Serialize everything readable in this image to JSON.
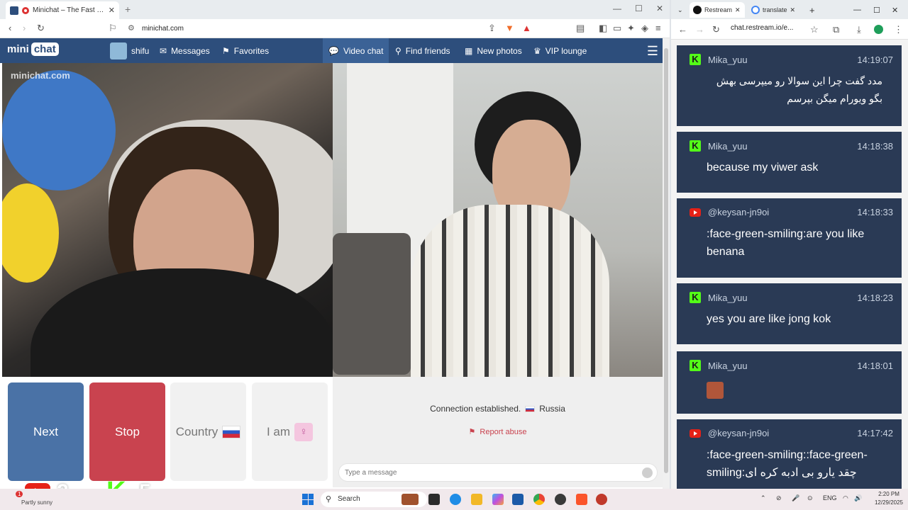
{
  "left_browser": {
    "tab_title": "Minichat – The Fast Video Ch",
    "url": "minichat.com"
  },
  "site_nav": {
    "logo_left": "mini",
    "logo_right": "chat",
    "user": "shifu",
    "messages": "Messages",
    "favorites": "Favorites",
    "video_chat": "Video chat",
    "find_friends": "Find friends",
    "new_photos": "New photos",
    "vip_lounge": "VIP lounge"
  },
  "watermark": "minichat.com",
  "controls": {
    "next": "Next",
    "stop": "Stop",
    "country": "Country",
    "i_am": "I am"
  },
  "chat_panel": {
    "connection": "Connection established.",
    "country": "Russia",
    "report_abuse": "Report abuse",
    "message_placeholder": "Type a message"
  },
  "stream_overlay": {
    "youtube_viewers": "2",
    "kick_viewers": "5",
    "kick_logo": "K"
  },
  "right_browser": {
    "tab1_title": "Restream",
    "tab2_title": "translate",
    "url": "chat.restream.io/e..."
  },
  "chat_messages": [
    {
      "platform": "kick",
      "user": "Mika_yuu",
      "time": "14:19:07",
      "text": "مدد گفت چرا این سوالا رو میپرسی بهش بگو ویورام میگن بپرسم"
    },
    {
      "platform": "kick",
      "user": "Mika_yuu",
      "time": "14:18:38",
      "text": "because my viwer ask"
    },
    {
      "platform": "youtube",
      "user": "@keysan-jn9oi",
      "time": "14:18:33",
      "text": ":face-green-smiling:are you like benana"
    },
    {
      "platform": "kick",
      "user": "Mika_yuu",
      "time": "14:18:23",
      "text": "yes you are like jong kok"
    },
    {
      "platform": "kick",
      "user": "Mika_yuu",
      "time": "14:18:01",
      "text": ""
    },
    {
      "platform": "youtube",
      "user": "@keysan-jn9oi",
      "time": "14:17:42",
      "text": ":face-green-smiling::face-green-smiling:چقد یارو بی ادبه کره ای"
    }
  ],
  "taskbar": {
    "weather": "Partly sunny",
    "weather_badge": "1",
    "search": "Search",
    "lang": "ENG",
    "time": "2:20 PM",
    "date": "12/29/2025"
  },
  "colors": {
    "nav_bg": "#2d4e7c",
    "next_btn": "#4a72a6",
    "stop_btn": "#c9434f",
    "chat_card": "#2a3a55",
    "kick_green": "#53fc18",
    "youtube_red": "#e62117"
  }
}
